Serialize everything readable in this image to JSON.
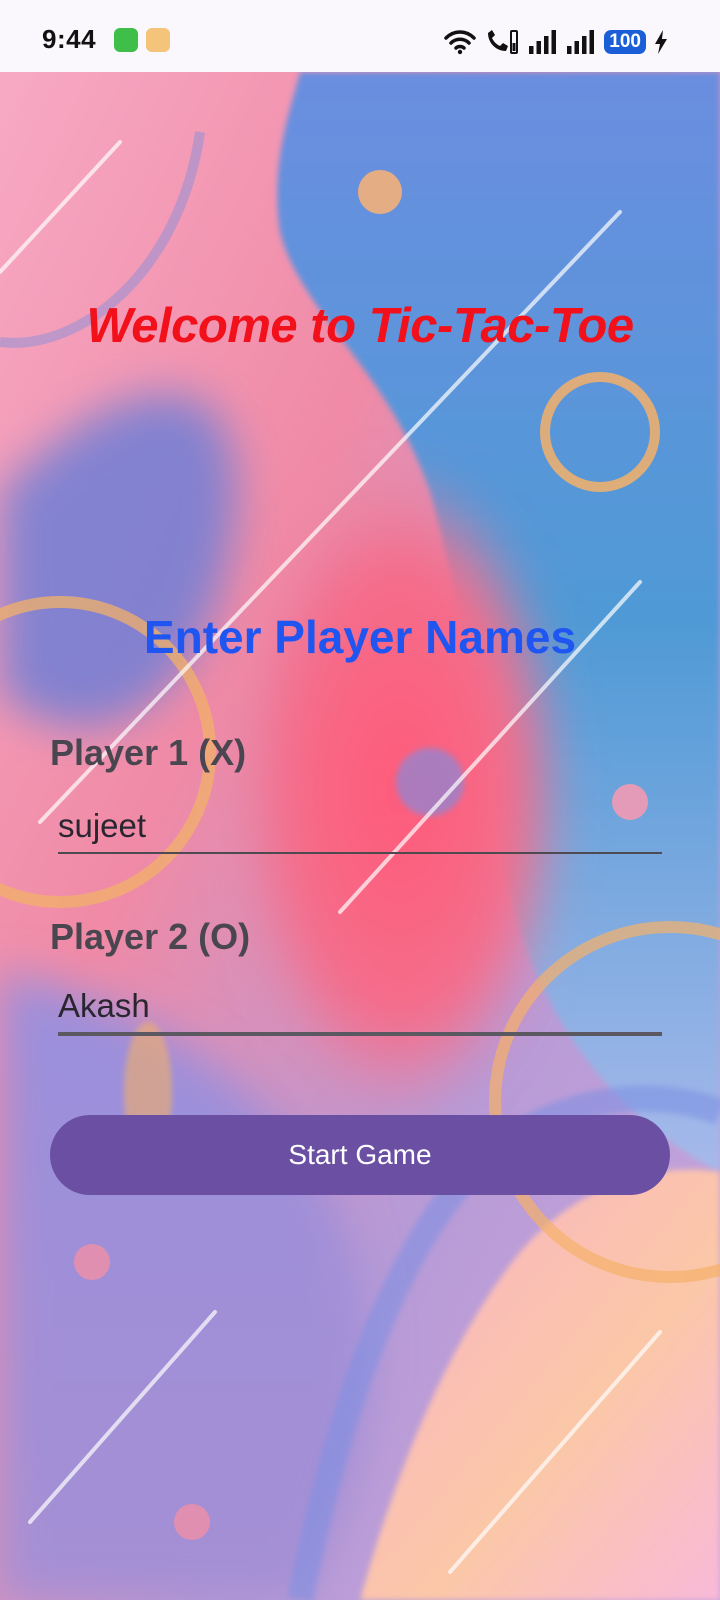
{
  "status_bar": {
    "time": "9:44",
    "battery_level": "100",
    "icons": [
      "app-icon-1",
      "app-icon-2",
      "wifi-icon",
      "wifi-call-icon",
      "signal-icon-sim1",
      "signal-icon-sim2",
      "battery-icon",
      "charging-bolt-icon"
    ]
  },
  "screen": {
    "title": "Welcome to Tic-Tac-Toe",
    "heading": "Enter Player Names",
    "player1": {
      "label": "Player 1 (X)",
      "value": "sujeet"
    },
    "player2": {
      "label": "Player 2 (O)",
      "value": "Akash"
    },
    "start_button_label": "Start Game"
  },
  "colors": {
    "title": "#f2101a",
    "heading": "#1f55f0",
    "label": "#4a4650",
    "button": "#6a4fa3",
    "button_text": "#ffffff",
    "battery_badge": "#1a5fd8"
  }
}
